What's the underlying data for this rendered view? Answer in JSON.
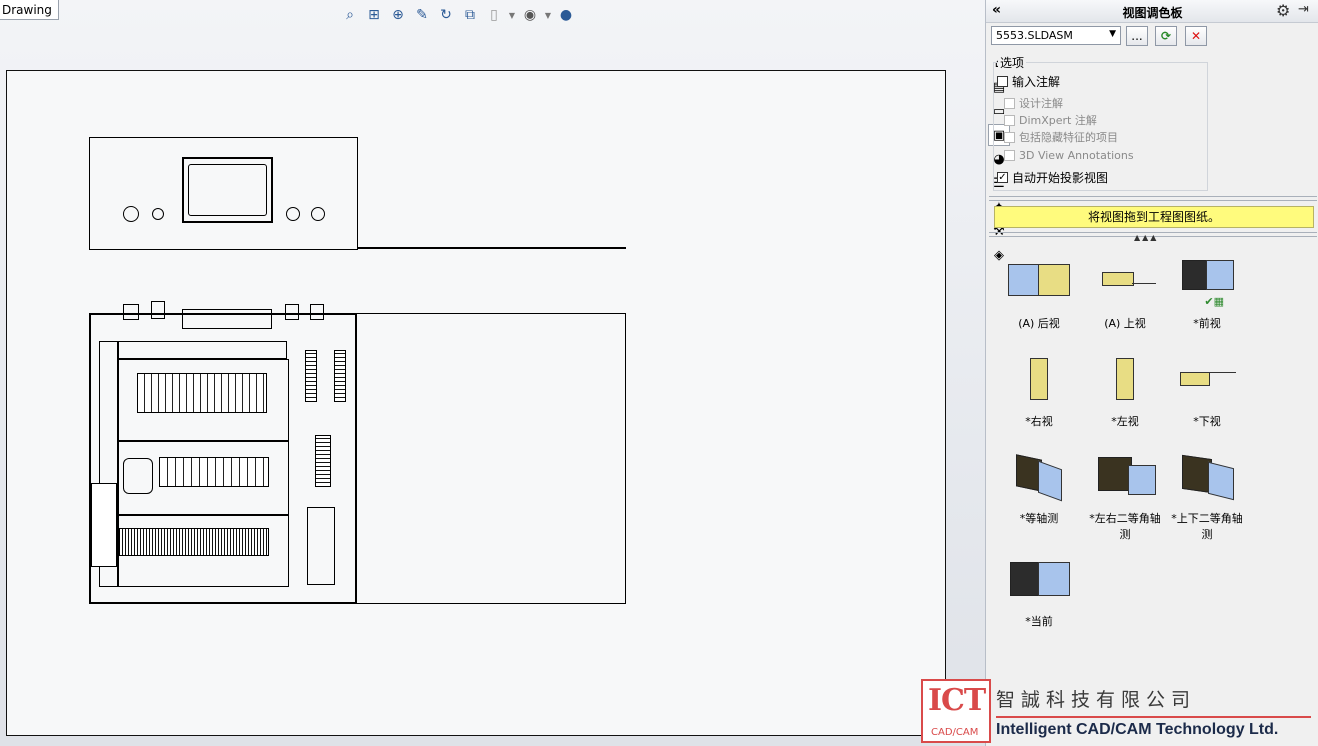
{
  "canvas": {
    "tab_label": "Drawing",
    "toolbar_icons": [
      "zoom-to-fit-icon",
      "zoom-area-icon",
      "zoom-in-out-icon",
      "previous-view-icon",
      "rotate-icon",
      "section-view-icon",
      "display-style-icon",
      "view-orientation-icon",
      "appearance-icon"
    ]
  },
  "panel": {
    "title": "视图调色板",
    "collapse_glyph": "«",
    "file": "5553.SLDASM",
    "browse_label": "...",
    "options": {
      "title": "选项",
      "import_annotations": {
        "label": "输入注解",
        "checked": false
      },
      "design_annotations": {
        "label": "设计注解",
        "checked": false
      },
      "dimxpert": {
        "label": "DimXpert 注解",
        "checked": false
      },
      "hidden_features": {
        "label": "包括隐藏特征的项目",
        "checked": false
      },
      "view3d": {
        "label": "3D View Annotations",
        "checked": false
      },
      "auto_projection": {
        "label": "自动开始投影视图",
        "checked": true
      }
    },
    "drag_hint": "将视图拖到工程图图纸。",
    "views": [
      {
        "label": "(A) 后视"
      },
      {
        "label": "(A) 上视"
      },
      {
        "label": "*前视"
      },
      {
        "label": "*右视"
      },
      {
        "label": "*左视"
      },
      {
        "label": "*下视"
      },
      {
        "label": "*等轴测"
      },
      {
        "label": "*左右二等角轴测"
      },
      {
        "label": "*上下二等角轴测"
      },
      {
        "label": "*当前"
      }
    ]
  },
  "logo": {
    "abbr": "ICT",
    "sub": "CAD/CAM",
    "chinese": "智誠科技有限公司",
    "english": "Intelligent CAD/CAM Technology Ltd."
  },
  "colors": {
    "hint_yellow": "#fffb7d",
    "logo_red": "#d94a4a",
    "part_yellow": "#e8dd84",
    "part_blue": "#a8c4ec"
  }
}
